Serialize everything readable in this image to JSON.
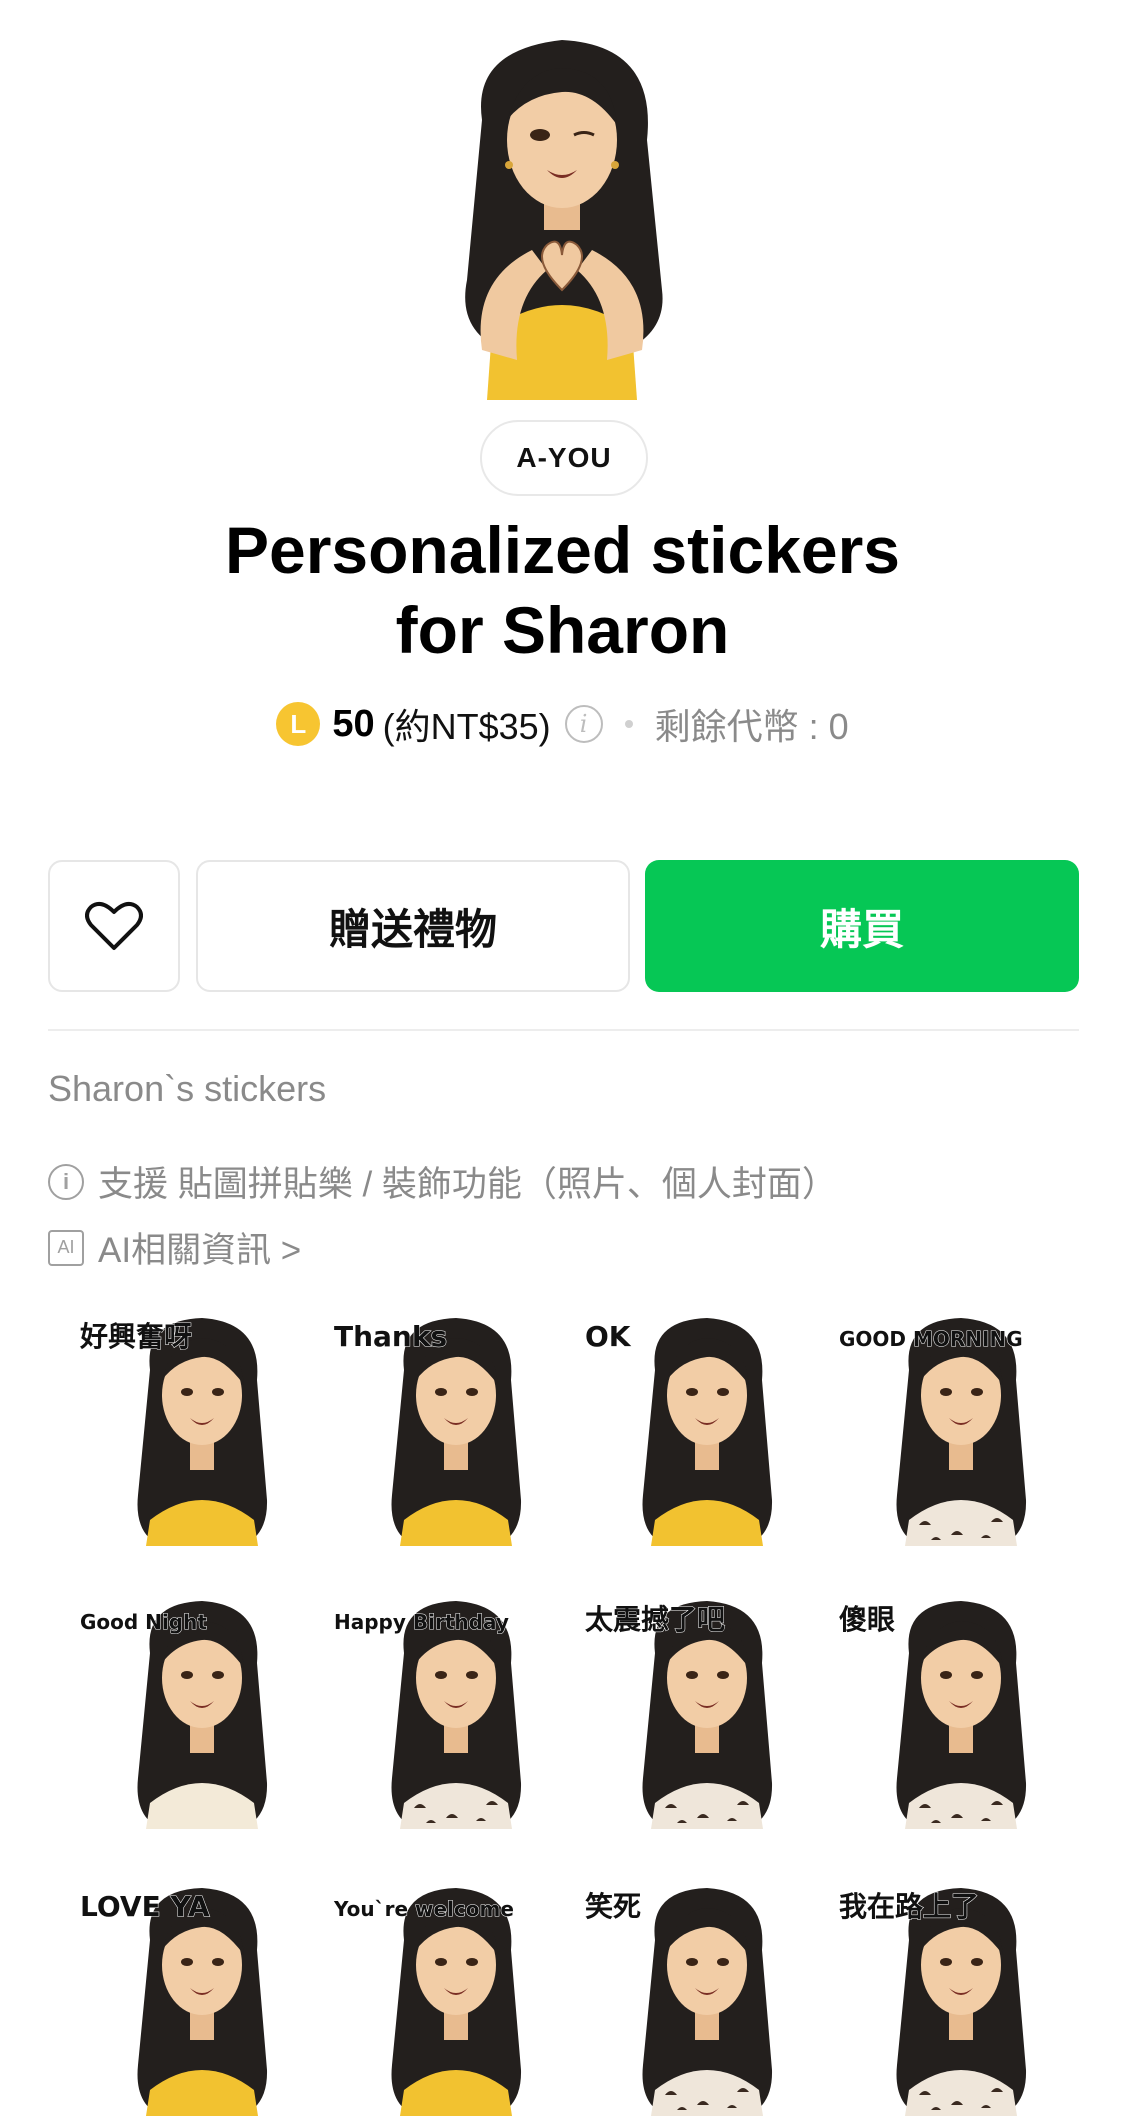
{
  "header": {
    "author": "A-YOU",
    "title_line1": "Personalized stickers",
    "title_line2": "for Sharon"
  },
  "price": {
    "coin_label": "L",
    "amount": "50",
    "nt_price": "(約NT$35)",
    "info_symbol": "i",
    "balance": "剩餘代幣 : 0"
  },
  "actions": {
    "gift_label": "贈送禮物",
    "buy_label": "購買",
    "favorite_icon": "heart-outline-icon"
  },
  "section": {
    "title": "Sharon`s stickers",
    "support_note": "支援 貼圖拼貼樂 / 裝飾功能（照片、個人封面）",
    "ai_label": "AI",
    "ai_info": "AI相關資訊 >"
  },
  "stickers": [
    {
      "caption": "好興奮呀",
      "dress": "yellow"
    },
    {
      "caption": "Thanks",
      "dress": "yellow"
    },
    {
      "caption": "OK",
      "dress": "yellow"
    },
    {
      "caption": "GOOD MORNING",
      "dress": "fur"
    },
    {
      "caption": "Good Night",
      "dress": "pajama"
    },
    {
      "caption": "Happy Birthday",
      "dress": "fur"
    },
    {
      "caption": "太震撼了吧",
      "dress": "fur"
    },
    {
      "caption": "傻眼",
      "dress": "fur"
    },
    {
      "caption": "LOVE YA",
      "dress": "yellow"
    },
    {
      "caption": "You`re welcome",
      "dress": "yellow"
    },
    {
      "caption": "笑死",
      "dress": "fur"
    },
    {
      "caption": "我在路上了",
      "dress": "fur"
    }
  ],
  "colors": {
    "buy_green": "#06c755",
    "coin_yellow": "#f7c531",
    "muted_text": "#8a8a8a"
  }
}
